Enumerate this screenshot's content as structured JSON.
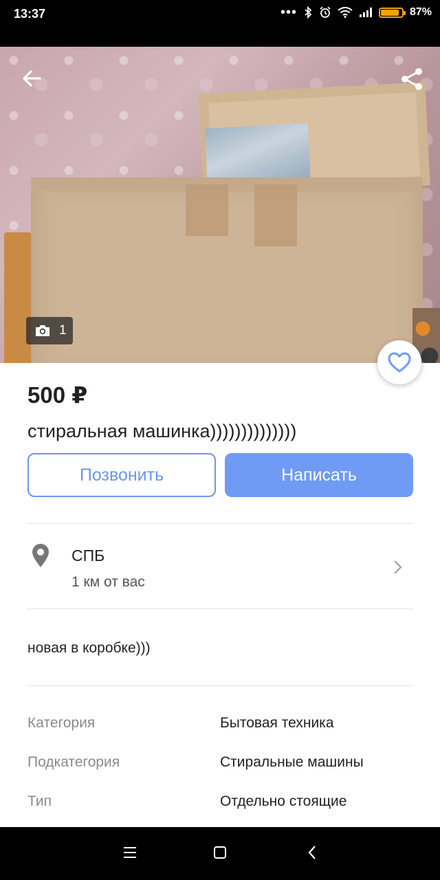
{
  "status_bar": {
    "time": "13:37",
    "battery_percent": "87%",
    "battery_level": 0.87,
    "icons": [
      "more-dots-icon",
      "bluetooth-icon",
      "alarm-icon",
      "wifi-icon",
      "signal-icon",
      "battery-icon"
    ]
  },
  "photo": {
    "count": "1",
    "icons": [
      "back-arrow-icon",
      "share-icon",
      "camera-icon"
    ]
  },
  "favorite": {
    "icon": "heart-outline-icon",
    "color": "#6f9bf5"
  },
  "listing": {
    "price": "500 ₽",
    "title": "стиральная машинка))))))))))))))",
    "description": "новая в коробке)))"
  },
  "actions": {
    "call_label": "Позвонить",
    "write_label": "Написать",
    "accent_color": "#6f9bf5"
  },
  "location": {
    "city": "СПБ",
    "distance": "1 км от вас",
    "icons": [
      "location-pin-icon",
      "chevron-right-icon"
    ]
  },
  "properties": [
    {
      "key": "Категория",
      "value": "Бытовая техника"
    },
    {
      "key": "Подкатегория",
      "value": "Стиральные машины"
    },
    {
      "key": "Тип",
      "value": "Отдельно стоящие"
    }
  ],
  "navbar": {
    "icons": [
      "menu-icon",
      "home-square-icon",
      "back-chevron-icon"
    ]
  }
}
